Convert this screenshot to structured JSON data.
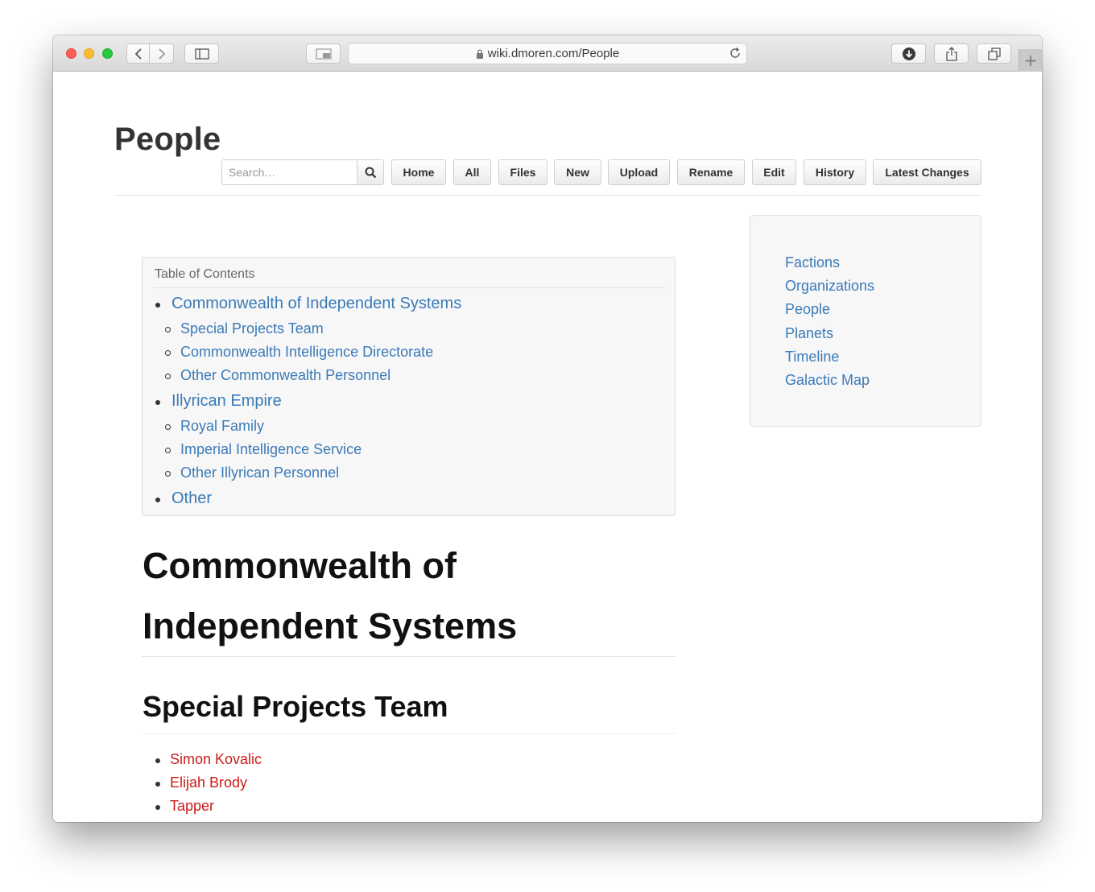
{
  "browser": {
    "url": "wiki.dmoren.com/People"
  },
  "page": {
    "title": "People",
    "search_placeholder": "Search…",
    "nav": {
      "home": "Home",
      "all": "All",
      "files": "Files",
      "new": "New",
      "upload": "Upload",
      "rename": "Rename",
      "edit": "Edit",
      "history": "History",
      "latest_changes": "Latest Changes"
    }
  },
  "sidebar": {
    "items": [
      "Factions",
      "Organizations",
      "People",
      "Planets",
      "Timeline",
      "Galactic Map"
    ]
  },
  "toc": {
    "title": "Table of Contents",
    "items": [
      {
        "label": "Commonwealth of Independent Systems",
        "level": 1
      },
      {
        "label": "Special Projects Team",
        "level": 2
      },
      {
        "label": "Commonwealth Intelligence Directorate",
        "level": 2
      },
      {
        "label": "Other Commonwealth Personnel",
        "level": 2
      },
      {
        "label": "Illyrican Empire",
        "level": 1
      },
      {
        "label": "Royal Family",
        "level": 2
      },
      {
        "label": "Imperial Intelligence Service",
        "level": 2
      },
      {
        "label": "Other Illyrican Personnel",
        "level": 2
      },
      {
        "label": "Other",
        "level": 1
      }
    ]
  },
  "section": {
    "heading_line1": "Commonwealth of",
    "heading_line2": "Independent Systems",
    "subheading": "Special Projects Team",
    "people": [
      "Simon Kovalic",
      "Elijah Brody",
      "Tapper"
    ]
  },
  "colors": {
    "link": "#3a7ab8",
    "missing_link": "#cc1b1b"
  }
}
